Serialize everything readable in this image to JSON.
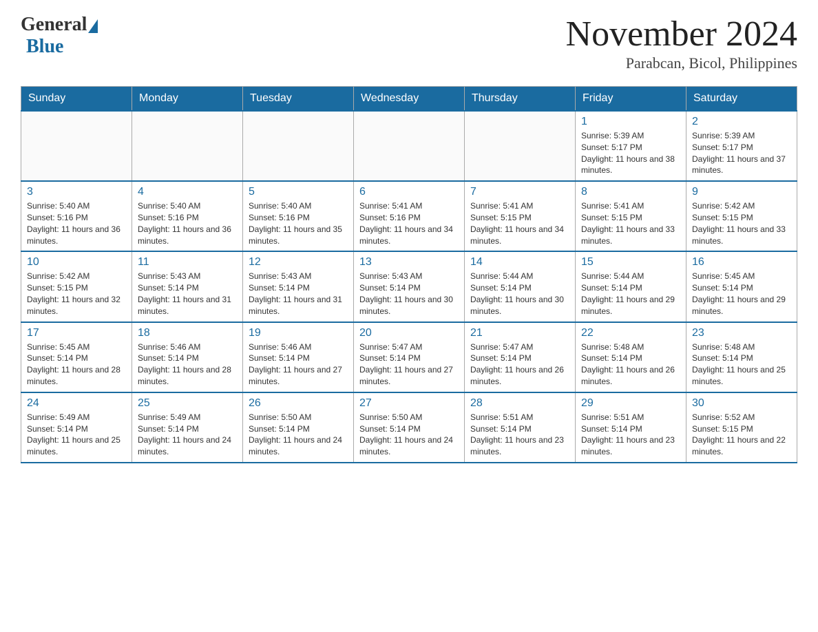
{
  "header": {
    "logo": {
      "general": "General",
      "blue": "Blue"
    },
    "title": "November 2024",
    "location": "Parabcan, Bicol, Philippines"
  },
  "weekdays": [
    "Sunday",
    "Monday",
    "Tuesday",
    "Wednesday",
    "Thursday",
    "Friday",
    "Saturday"
  ],
  "weeks": [
    [
      {
        "day": "",
        "info": ""
      },
      {
        "day": "",
        "info": ""
      },
      {
        "day": "",
        "info": ""
      },
      {
        "day": "",
        "info": ""
      },
      {
        "day": "",
        "info": ""
      },
      {
        "day": "1",
        "info": "Sunrise: 5:39 AM\nSunset: 5:17 PM\nDaylight: 11 hours and 38 minutes."
      },
      {
        "day": "2",
        "info": "Sunrise: 5:39 AM\nSunset: 5:17 PM\nDaylight: 11 hours and 37 minutes."
      }
    ],
    [
      {
        "day": "3",
        "info": "Sunrise: 5:40 AM\nSunset: 5:16 PM\nDaylight: 11 hours and 36 minutes."
      },
      {
        "day": "4",
        "info": "Sunrise: 5:40 AM\nSunset: 5:16 PM\nDaylight: 11 hours and 36 minutes."
      },
      {
        "day": "5",
        "info": "Sunrise: 5:40 AM\nSunset: 5:16 PM\nDaylight: 11 hours and 35 minutes."
      },
      {
        "day": "6",
        "info": "Sunrise: 5:41 AM\nSunset: 5:16 PM\nDaylight: 11 hours and 34 minutes."
      },
      {
        "day": "7",
        "info": "Sunrise: 5:41 AM\nSunset: 5:15 PM\nDaylight: 11 hours and 34 minutes."
      },
      {
        "day": "8",
        "info": "Sunrise: 5:41 AM\nSunset: 5:15 PM\nDaylight: 11 hours and 33 minutes."
      },
      {
        "day": "9",
        "info": "Sunrise: 5:42 AM\nSunset: 5:15 PM\nDaylight: 11 hours and 33 minutes."
      }
    ],
    [
      {
        "day": "10",
        "info": "Sunrise: 5:42 AM\nSunset: 5:15 PM\nDaylight: 11 hours and 32 minutes."
      },
      {
        "day": "11",
        "info": "Sunrise: 5:43 AM\nSunset: 5:14 PM\nDaylight: 11 hours and 31 minutes."
      },
      {
        "day": "12",
        "info": "Sunrise: 5:43 AM\nSunset: 5:14 PM\nDaylight: 11 hours and 31 minutes."
      },
      {
        "day": "13",
        "info": "Sunrise: 5:43 AM\nSunset: 5:14 PM\nDaylight: 11 hours and 30 minutes."
      },
      {
        "day": "14",
        "info": "Sunrise: 5:44 AM\nSunset: 5:14 PM\nDaylight: 11 hours and 30 minutes."
      },
      {
        "day": "15",
        "info": "Sunrise: 5:44 AM\nSunset: 5:14 PM\nDaylight: 11 hours and 29 minutes."
      },
      {
        "day": "16",
        "info": "Sunrise: 5:45 AM\nSunset: 5:14 PM\nDaylight: 11 hours and 29 minutes."
      }
    ],
    [
      {
        "day": "17",
        "info": "Sunrise: 5:45 AM\nSunset: 5:14 PM\nDaylight: 11 hours and 28 minutes."
      },
      {
        "day": "18",
        "info": "Sunrise: 5:46 AM\nSunset: 5:14 PM\nDaylight: 11 hours and 28 minutes."
      },
      {
        "day": "19",
        "info": "Sunrise: 5:46 AM\nSunset: 5:14 PM\nDaylight: 11 hours and 27 minutes."
      },
      {
        "day": "20",
        "info": "Sunrise: 5:47 AM\nSunset: 5:14 PM\nDaylight: 11 hours and 27 minutes."
      },
      {
        "day": "21",
        "info": "Sunrise: 5:47 AM\nSunset: 5:14 PM\nDaylight: 11 hours and 26 minutes."
      },
      {
        "day": "22",
        "info": "Sunrise: 5:48 AM\nSunset: 5:14 PM\nDaylight: 11 hours and 26 minutes."
      },
      {
        "day": "23",
        "info": "Sunrise: 5:48 AM\nSunset: 5:14 PM\nDaylight: 11 hours and 25 minutes."
      }
    ],
    [
      {
        "day": "24",
        "info": "Sunrise: 5:49 AM\nSunset: 5:14 PM\nDaylight: 11 hours and 25 minutes."
      },
      {
        "day": "25",
        "info": "Sunrise: 5:49 AM\nSunset: 5:14 PM\nDaylight: 11 hours and 24 minutes."
      },
      {
        "day": "26",
        "info": "Sunrise: 5:50 AM\nSunset: 5:14 PM\nDaylight: 11 hours and 24 minutes."
      },
      {
        "day": "27",
        "info": "Sunrise: 5:50 AM\nSunset: 5:14 PM\nDaylight: 11 hours and 24 minutes."
      },
      {
        "day": "28",
        "info": "Sunrise: 5:51 AM\nSunset: 5:14 PM\nDaylight: 11 hours and 23 minutes."
      },
      {
        "day": "29",
        "info": "Sunrise: 5:51 AM\nSunset: 5:14 PM\nDaylight: 11 hours and 23 minutes."
      },
      {
        "day": "30",
        "info": "Sunrise: 5:52 AM\nSunset: 5:15 PM\nDaylight: 11 hours and 22 minutes."
      }
    ]
  ]
}
